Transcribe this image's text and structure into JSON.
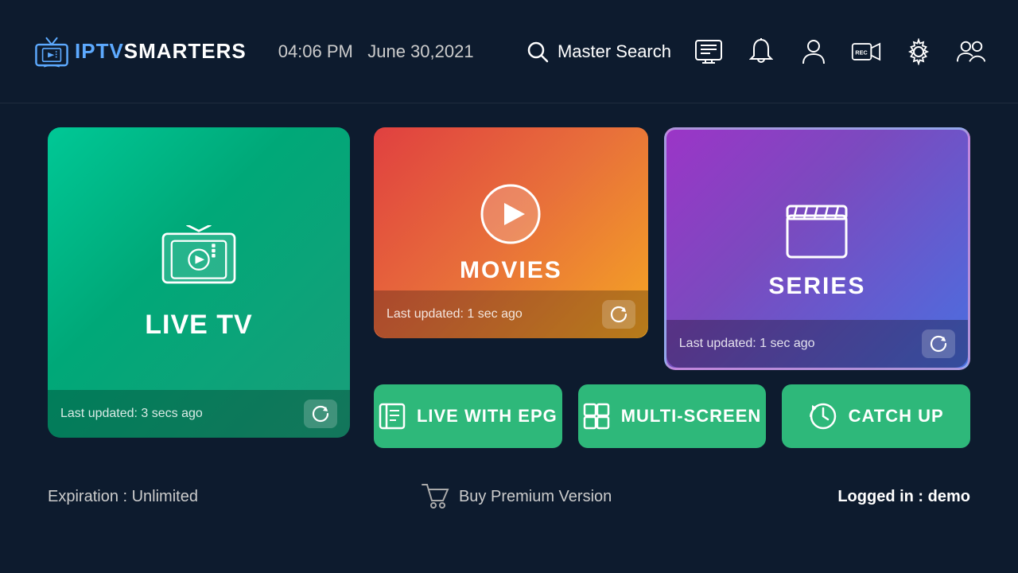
{
  "header": {
    "logo_iptv": "IPTV",
    "logo_smarters": "SMARTERS",
    "time": "04:06 PM",
    "date": "June 30,2021",
    "search_label": "Master Search"
  },
  "cards": {
    "live_tv": {
      "title": "LIVE TV",
      "updated": "Last updated: 3 secs ago"
    },
    "movies": {
      "title": "MOVIES",
      "updated": "Last updated: 1 sec ago"
    },
    "series": {
      "title": "SERIES",
      "updated": "Last updated: 1 sec ago"
    }
  },
  "buttons": {
    "live_with_epg": "LIVE WITH EPG",
    "multi_screen": "MULTI-SCREEN",
    "catch_up": "CATCH UP"
  },
  "footer": {
    "expiration": "Expiration : Unlimited",
    "buy_premium": "Buy Premium Version",
    "logged_in_label": "Logged in : ",
    "logged_in_user": "demo"
  }
}
